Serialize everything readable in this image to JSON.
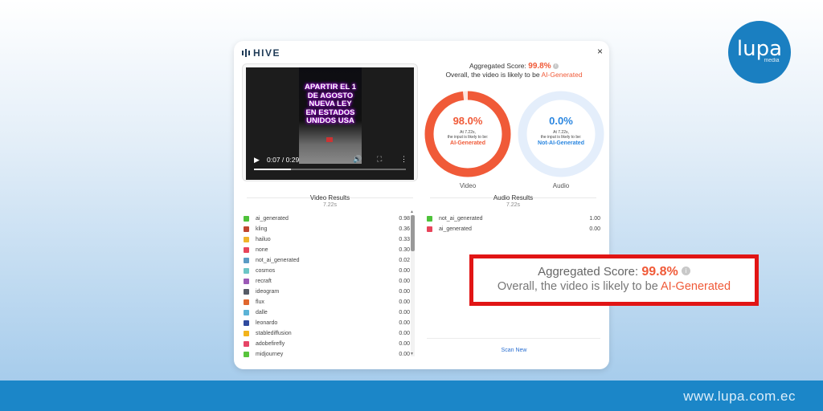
{
  "branding": {
    "hive_name": "HIVE",
    "lupa_word": "lupa",
    "lupa_sub": "media",
    "footer_url": "www.lupa.com.ec"
  },
  "modal": {
    "close_symbol": "×"
  },
  "video": {
    "overlay_lines": [
      "APARTIR EL 1",
      "DE AGOSTO",
      "NUEVA LEY",
      "EN ESTADOS",
      "UNIDOS USA"
    ],
    "time": "0:07 / 0:29",
    "progress_fraction": 0.241
  },
  "aggregate": {
    "label": "Aggregated Score:",
    "score": "99.8%",
    "line2_prefix": "Overall, the video is likely to be",
    "line2_result": "AI-Generated"
  },
  "rings": {
    "video": {
      "pct": "98.0%",
      "pct_value": 0.98,
      "sub1": "At 7.22s,",
      "sub2": "the input is likely to be:",
      "result": "AI-Generated",
      "label": "Video",
      "color": "#f05a38"
    },
    "audio": {
      "pct": "0.0%",
      "pct_value": 0.0,
      "sub1": "At 7.22s,",
      "sub2": "the input is likely to be:",
      "result": "Not-AI-Generated",
      "label": "Audio",
      "color": "#2a86e0"
    }
  },
  "video_results": {
    "title": "Video Results",
    "time": "7.22s",
    "rows": [
      {
        "name": "ai_generated",
        "value": "0.98",
        "color": "#4ec23a"
      },
      {
        "name": "kling",
        "value": "0.36",
        "color": "#c0462e"
      },
      {
        "name": "hailuo",
        "value": "0.33",
        "color": "#f0b429"
      },
      {
        "name": "none",
        "value": "0.30",
        "color": "#e8445a"
      },
      {
        "name": "not_ai_generated",
        "value": "0.02",
        "color": "#5a9bc4"
      },
      {
        "name": "cosmos",
        "value": "0.00",
        "color": "#6cc6c6"
      },
      {
        "name": "recraft",
        "value": "0.00",
        "color": "#9b59b6"
      },
      {
        "name": "ideogram",
        "value": "0.00",
        "color": "#555b66"
      },
      {
        "name": "flux",
        "value": "0.00",
        "color": "#e0672e"
      },
      {
        "name": "dalle",
        "value": "0.00",
        "color": "#5bb3d6"
      },
      {
        "name": "leonardo",
        "value": "0.00",
        "color": "#2f4a9e"
      },
      {
        "name": "stablediffusion",
        "value": "0.00",
        "color": "#f2b31b"
      },
      {
        "name": "adobefirefly",
        "value": "0.00",
        "color": "#e64566"
      },
      {
        "name": "midjourney",
        "value": "0.00",
        "color": "#58c43c"
      }
    ]
  },
  "audio_results": {
    "title": "Audio Results",
    "time": "7.22s",
    "rows": [
      {
        "name": "not_ai_generated",
        "value": "1.00",
        "color": "#4ec23a"
      },
      {
        "name": "ai_generated",
        "value": "0.00",
        "color": "#e8445a"
      }
    ]
  },
  "scan_new": "Scan New",
  "callout": {
    "label": "Aggregated Score:",
    "score": "99.8%",
    "line2_prefix": "Overall, the video is likely to be",
    "line2_result": "AI-Generated"
  }
}
